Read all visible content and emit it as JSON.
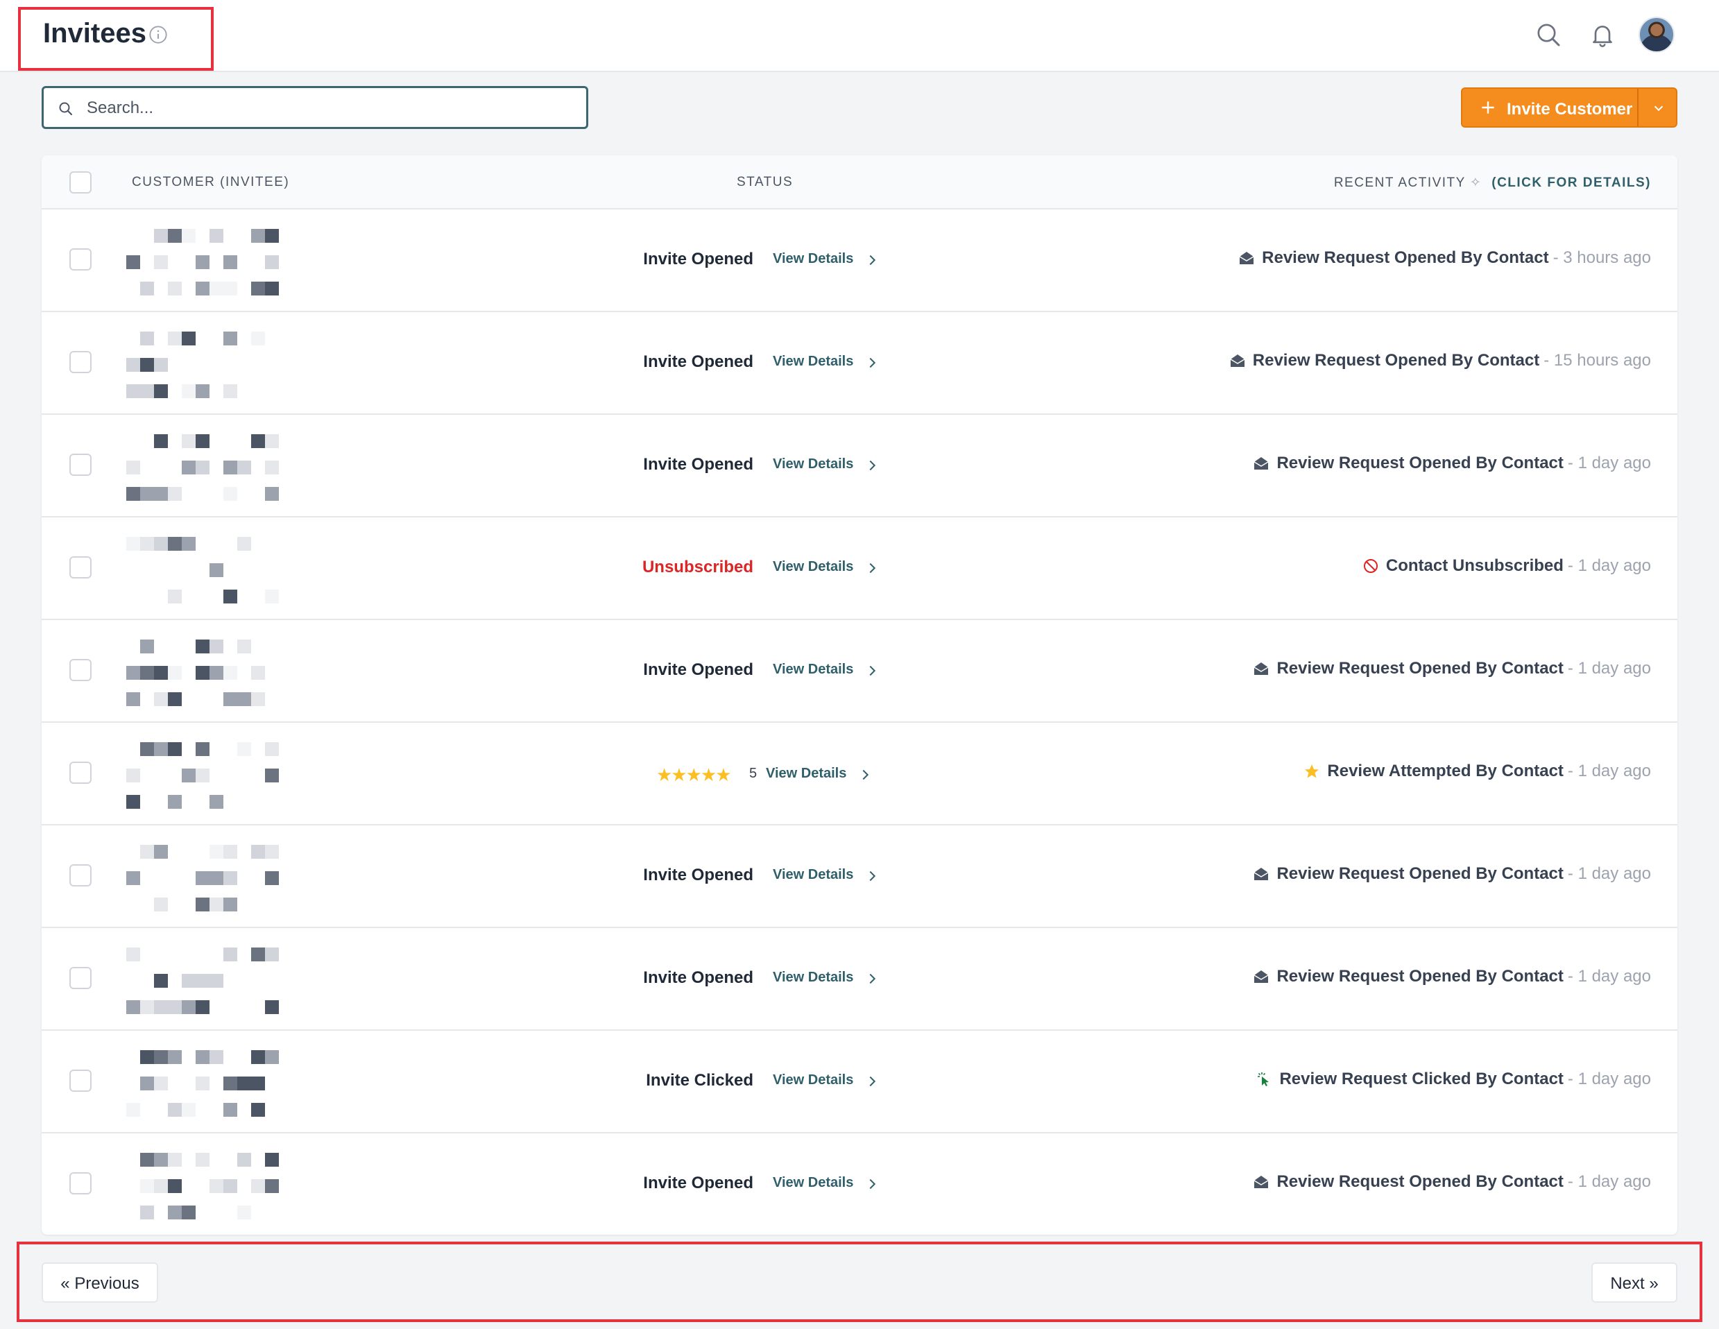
{
  "header": {
    "title": "Invitees",
    "icons": [
      "info-icon",
      "search-icon",
      "bell-icon",
      "user-avatar"
    ]
  },
  "search": {
    "placeholder": "Search..."
  },
  "invite_button": {
    "label": "Invite Customer",
    "icons": [
      "plus-icon",
      "chevron-down-icon"
    ]
  },
  "table": {
    "headers": {
      "customer": "CUSTOMER (INVITEE)",
      "status": "STATUS",
      "recent": "RECENT ACTIVITY",
      "recent_link": "(CLICK FOR DETAILS)"
    },
    "rows": [
      {
        "status": "Invite Opened",
        "status_color": "normal",
        "details": "View Details",
        "activity_icon": "envelope-open-icon",
        "activity": "Review Request Opened By Contact",
        "time": "- 3 hours ago"
      },
      {
        "status": "Invite Opened",
        "status_color": "normal",
        "details": "View Details",
        "activity_icon": "envelope-open-icon",
        "activity": "Review Request Opened By Contact",
        "time": "- 15 hours ago"
      },
      {
        "status": "Invite Opened",
        "status_color": "normal",
        "details": "View Details",
        "activity_icon": "envelope-open-icon",
        "activity": "Review Request Opened By Contact",
        "time": "- 1 day ago"
      },
      {
        "status": "Unsubscribed",
        "status_color": "#dc2626",
        "details": "View Details",
        "activity_icon": "ban-icon",
        "activity": "Contact Unsubscribed",
        "time": "- 1 day ago"
      },
      {
        "status": "Invite Opened",
        "status_color": "normal",
        "details": "View Details",
        "activity_icon": "envelope-open-icon",
        "activity": "Review Request Opened By Contact",
        "time": "- 1 day ago"
      },
      {
        "status": "★★★★★",
        "rating": 5,
        "rating_label": "5",
        "details": "View Details",
        "activity_icon": "star-icon",
        "activity": "Review Attempted By Contact",
        "time": "- 1 day ago"
      },
      {
        "status": "Invite Opened",
        "status_color": "normal",
        "details": "View Details",
        "activity_icon": "envelope-open-icon",
        "activity": "Review Request Opened By Contact",
        "time": "- 1 day ago"
      },
      {
        "status": "Invite Opened",
        "status_color": "normal",
        "details": "View Details",
        "activity_icon": "envelope-open-icon",
        "activity": "Review Request Opened By Contact",
        "time": "- 1 day ago"
      },
      {
        "status": "Invite Clicked",
        "status_color": "normal",
        "details": "View Details",
        "activity_icon": "cursor-click-icon",
        "activity": "Review Request Clicked By Contact",
        "time": "- 1 day ago"
      },
      {
        "status": "Invite Opened",
        "status_color": "normal",
        "details": "View Details",
        "activity_icon": "envelope-open-icon",
        "activity": "Review Request Opened By Contact",
        "time": "- 1 day ago"
      }
    ]
  },
  "pagination": {
    "previous": "« Previous",
    "next": "Next »"
  },
  "colors": {
    "accent": "#f48c1e",
    "link": "#2f5f6b",
    "highlight": "#e8313f",
    "danger": "#dc2626",
    "star": "#fbbf24"
  }
}
